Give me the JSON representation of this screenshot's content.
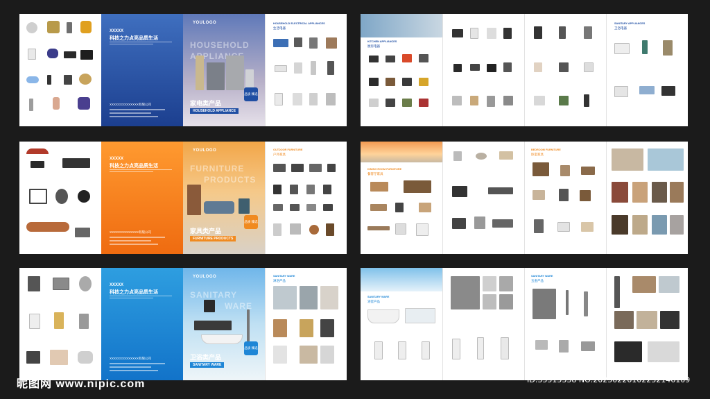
{
  "spreads": [
    {
      "id": "appliance-cover",
      "accent": "#1f4ea3",
      "left_label": "",
      "brand_x": "XXXXX",
      "brand_cn": "科技之力点亮品质生活",
      "company": "XXXXXXXXXXXXXX有限公司",
      "hero_logo": "YOULOGO",
      "hero_word_1": "HOUSEHOLD",
      "hero_word_2": "APPLIANCE",
      "hero_cn": "家电类产品",
      "hero_en": "HOUSEHOLD APPLIANCE",
      "badge": "品质 臻选",
      "right_title": "HOUSEHOLD ELECTRICAL APPLIANCES",
      "right_sub": "生活电器"
    },
    {
      "id": "furniture-cover",
      "accent": "#f08a20",
      "brand_x": "XXXXX",
      "brand_cn": "科技之力点亮品质生活",
      "company": "XXXXXXXXXXXXXX有限公司",
      "hero_logo": "YOULOGO",
      "hero_word_1": "FURNITURE",
      "hero_word_2": "PRODUCTS",
      "hero_cn": "家具类产品",
      "hero_en": "FURNITURE PRODUCTS",
      "badge": "品质 臻选",
      "right_title": "OUTDOOR FURNITURE",
      "right_sub": "户外家具"
    },
    {
      "id": "sanitary-cover",
      "accent": "#1e86d6",
      "brand_x": "XXXXX",
      "brand_cn": "科技之力点亮品质生活",
      "company": "XXXXXXXXXXXXXX有限公司",
      "hero_logo": "YOULOGO",
      "hero_word_1": "SANITARY",
      "hero_word_2": "WARE",
      "hero_cn": "卫浴类产品",
      "hero_en": "SANITARY WARE",
      "badge": "品质 臻选",
      "right_title": "SANITARY WARE",
      "right_sub": "淋浴产品"
    }
  ],
  "inner": [
    {
      "id": "kitchen",
      "title_1": "KITCHEN APPLIANCES",
      "sub_1": "厨房电器",
      "title_2": "SANITARY APPLIANCES",
      "sub_2": "卫浴电器"
    },
    {
      "id": "dining",
      "title_1": "DINING ROOM FURNITURE",
      "sub_1": "餐客厅家具",
      "title_2": "BEDROOM FURNITURE",
      "sub_2": "卧室家具"
    },
    {
      "id": "bath",
      "title_1": "SANITARY WARE",
      "sub_1": "浴室产品",
      "title_2": "SANITARY WARE",
      "sub_2": "五金产品"
    }
  ],
  "watermark": {
    "left": "昵图网 www.nipic.com",
    "right": "ID:35515338 NO:20250226102232146109"
  },
  "colors": {
    "blue": "#1f4ea3",
    "orange": "#f08a20",
    "cyan": "#1e86d6",
    "dark_bg": "#1b1b1b"
  }
}
